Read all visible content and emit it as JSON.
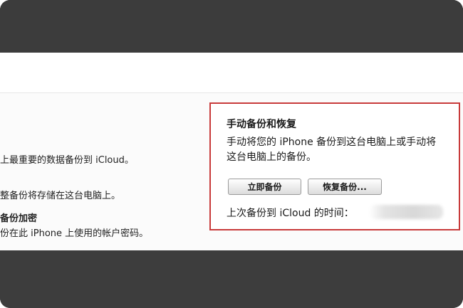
{
  "left_panel": {
    "line1": "上最重要的数据备份到 iCloud。",
    "line2": "整备份将存储在这台电脑上。",
    "line3": "备份加密",
    "line4": "份在此 iPhone 上使用的帐户密码。"
  },
  "manual_backup": {
    "title": "手动备份和恢复",
    "desc_line1": "手动将您的 iPhone 备份到这台电脑上或手动将",
    "desc_line2": "这台电脑上的备份。",
    "backup_now_label": "立即备份",
    "restore_label": "恢复备份...",
    "last_backup_label": "上次备份到 iCloud 的时间："
  },
  "colors": {
    "frame": "#3a3a3a",
    "highlight_border": "#c83a3a"
  }
}
